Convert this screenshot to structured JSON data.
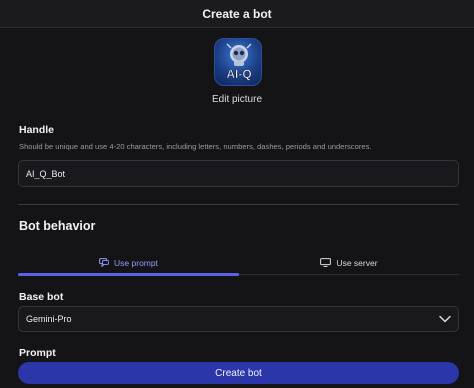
{
  "header": {
    "title": "Create a bot"
  },
  "avatar": {
    "logo_text": "AI-Q",
    "edit_label": "Edit picture"
  },
  "handle": {
    "label": "Handle",
    "helper": "Should be unique and use 4-20 characters, including letters, numbers, dashes, periods and underscores.",
    "value": "AI_Q_Bot"
  },
  "behavior": {
    "title": "Bot behavior",
    "tabs": [
      {
        "label": "Use prompt",
        "icon": "chat-icon",
        "active": true
      },
      {
        "label": "Use server",
        "icon": "monitor-icon",
        "active": false
      }
    ]
  },
  "base_bot": {
    "label": "Base bot",
    "value": "Gemini-Pro"
  },
  "prompt": {
    "label": "Prompt"
  },
  "actions": {
    "create_label": "Create bot"
  },
  "colors": {
    "accent": "#5a63e6",
    "button": "#2b36a8",
    "active_tab_text": "#8f9cff"
  }
}
